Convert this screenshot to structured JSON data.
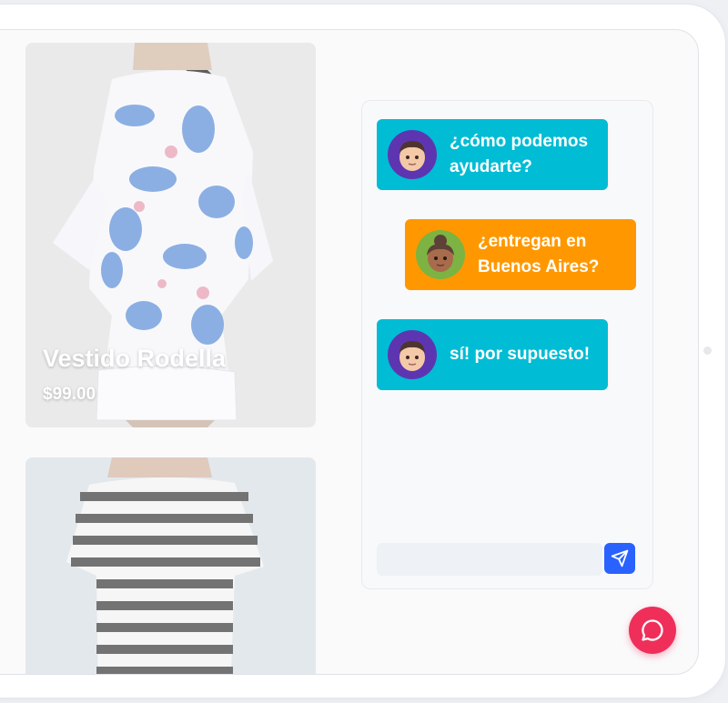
{
  "products": [
    {
      "name": "Vestido Rodella",
      "price": "$99.00",
      "image": "patterned-dress-photo"
    },
    {
      "name": "",
      "price": "",
      "image": "striped-tshirt-photo"
    }
  ],
  "chat": {
    "messages": [
      {
        "from": "agent",
        "avatar": "agent-avatar-icon",
        "text": "¿cómo podemos\nayudarte?"
      },
      {
        "from": "user",
        "avatar": "user-avatar-icon",
        "text": "¿entregan en\nBuenos Aires?"
      },
      {
        "from": "agent",
        "avatar": "agent-avatar-icon",
        "text": "sí! por supuesto!"
      }
    ],
    "input": {
      "value": "",
      "placeholder": ""
    },
    "send_icon": "send-icon",
    "launcher_icon": "chat-bubble-icon"
  },
  "colors": {
    "agent_bubble": "#00bcd4",
    "user_bubble": "#ff9800",
    "send_button": "#2962ff",
    "launcher": "#ef2f5a"
  }
}
